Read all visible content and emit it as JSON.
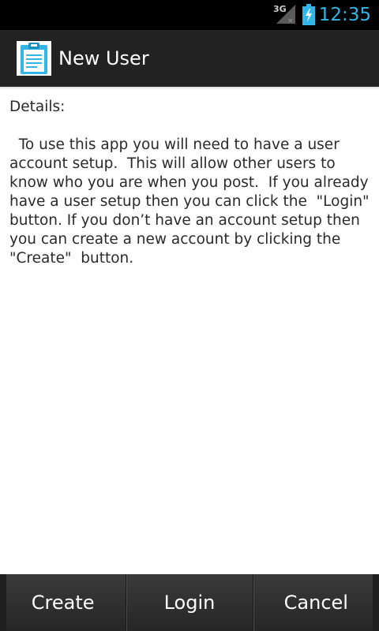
{
  "status_bar": {
    "network_type": "3G",
    "time": "12:35",
    "signal_icon": "signal-icon",
    "battery_icon": "battery-charging-icon",
    "time_color": "#33b5e5"
  },
  "action_bar": {
    "title": "New User",
    "app_icon": "clipboard-icon"
  },
  "content": {
    "heading": "Details:",
    "body": "  To use this app you will need to have a user account setup.  This will allow other users to know who you are when you post.  If you already have a user setup then you can click the  \"Login\" button. If you don’t have an account setup then you can create a new account by clicking the \"Create\"  button."
  },
  "buttons": {
    "create_label": "Create",
    "login_label": "Login",
    "cancel_label": "Cancel"
  }
}
